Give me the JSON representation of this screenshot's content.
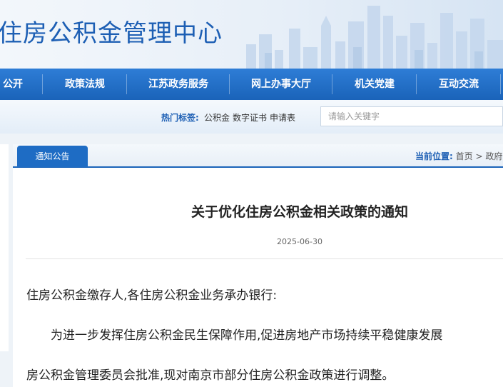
{
  "site": {
    "title": "住房公积金管理中心"
  },
  "nav": {
    "items": [
      {
        "label": "公开"
      },
      {
        "label": "政策法规"
      },
      {
        "label": "江苏政务服务"
      },
      {
        "label": "网上办事大厅"
      },
      {
        "label": "机关党建"
      },
      {
        "label": "互动交流"
      }
    ]
  },
  "search": {
    "tags_label": "热门标签:",
    "tags": [
      "公积金",
      "数字证书",
      "申请表"
    ],
    "placeholder": "请输入关键字"
  },
  "content": {
    "tab_label": "通知公告",
    "location_label": "当前位置:",
    "breadcrumb": [
      "首页",
      "政府信"
    ],
    "breadcrumb_sep": ">"
  },
  "article": {
    "title": "关于优化住房公积金相关政策的通知",
    "date": "2025-06-30",
    "paragraphs": [
      "住房公积金缴存人,各住房公积金业务承办银行:",
      "为进一步发挥住房公积金民生保障作用,促进房地产市场持续平稳健康发展",
      "房公积金管理委员会批准,现对南京市部分住房公积金政策进行调整。"
    ]
  },
  "colors": {
    "brand": "#1d5fb4",
    "nav": "#1a63b9",
    "tab": "#1e6cc4"
  }
}
